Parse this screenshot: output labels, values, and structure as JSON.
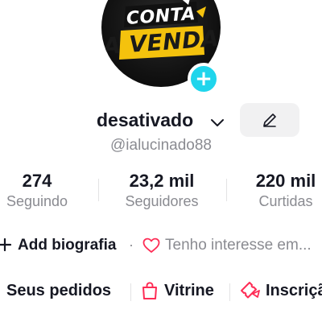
{
  "profile": {
    "avatar_line1": "CONTA",
    "avatar_line2": "A VENDA",
    "username": "desativado",
    "handle": "@ialucinado88"
  },
  "stats": [
    {
      "value": "274",
      "label": "Seguindo"
    },
    {
      "value": "23,2 mil",
      "label": "Seguidores"
    },
    {
      "value": "220 mil",
      "label": "Curtidas"
    }
  ],
  "bio": {
    "add_label": "Add biografia",
    "separator": "·",
    "interest_label": "Tenho interesse em..."
  },
  "shortcuts": {
    "orders_label": "Seus pedidos",
    "showcase_label": "Vitrine",
    "subscription_label": "Inscrição"
  },
  "colors": {
    "accent": "#20d5ec",
    "heart": "#fe2c55",
    "text": "#161823",
    "muted": "#8a8b91"
  },
  "icons": {
    "add_badge": "plus-icon",
    "username_dropdown": "chevron-down-icon",
    "edit": "pencil-icon",
    "add_bio": "plus-icon",
    "interest": "heart-icon",
    "showcase": "shopping-bag-icon",
    "subscription": "ticket-icon"
  }
}
